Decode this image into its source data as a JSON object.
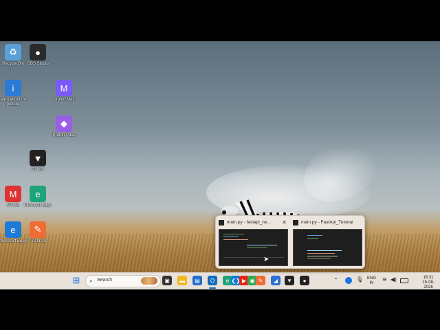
{
  "desktop": {
    "icons": [
      {
        "label": "Recycle Bin",
        "glyph": "♻",
        "color": "#5aa0d8"
      },
      {
        "label": "OBS Studio",
        "glyph": "●",
        "color": "#2a2a2a"
      },
      {
        "label": "Learn about this picture",
        "glyph": "i",
        "color": "#2b7bd6"
      },
      {
        "label": "Proton Mail",
        "glyph": "M",
        "color": "#7a5af8"
      },
      {
        "label": "Proton Pass",
        "glyph": "◆",
        "color": "#9b5de5"
      },
      {
        "label": "Canon",
        "glyph": "▼",
        "color": "#222222"
      },
      {
        "label": "MARG",
        "glyph": "M",
        "color": "#d33"
      },
      {
        "label": "Microsoft Edge",
        "glyph": "e",
        "color": "#1fa37a"
      },
      {
        "label": "Microsoft Edge",
        "glyph": "e",
        "color": "#1f7ad6"
      },
      {
        "label": "Postman",
        "glyph": "✎",
        "color": "#ef6c35"
      }
    ]
  },
  "taskbar": {
    "search_label": "Search",
    "icons": [
      {
        "name": "start-icon",
        "glyph": "⊞",
        "color": "#1a73e8"
      },
      {
        "name": "task-view-icon",
        "glyph": "▣",
        "color": "#333333"
      },
      {
        "name": "file-explorer-icon",
        "glyph": "▬",
        "color": "#f2b820"
      },
      {
        "name": "store-icon",
        "glyph": "▤",
        "color": "#1f6fd1"
      },
      {
        "name": "outlook-icon",
        "glyph": "O",
        "color": "#0f6cbd"
      },
      {
        "name": "edge-icon",
        "glyph": "e",
        "color": "#1fa37a"
      },
      {
        "name": "vscode-icon",
        "glyph": "❮❯",
        "color": "#0b7bd4"
      },
      {
        "name": "youtube-icon",
        "glyph": "▶",
        "color": "#e62117"
      },
      {
        "name": "chrome-icon",
        "glyph": "◉",
        "color": "#34a853"
      },
      {
        "name": "postman-icon",
        "glyph": "✎",
        "color": "#ef6c35"
      },
      {
        "name": "app-blue-icon",
        "glyph": "◢",
        "color": "#2a6fd6"
      },
      {
        "name": "canon-icon",
        "glyph": "▼",
        "color": "#222222"
      },
      {
        "name": "obs-icon",
        "glyph": "●",
        "color": "#222222"
      }
    ],
    "tray": {
      "language_line1": "ENG",
      "language_line2": "IN",
      "time": "16:31",
      "date": "15-08-2026"
    }
  },
  "preview": {
    "windows": [
      {
        "title": "main.py - fastapi_ne..."
      },
      {
        "title": "main.py - FastApi_Tutorial..."
      }
    ],
    "close_glyph": "✕"
  }
}
